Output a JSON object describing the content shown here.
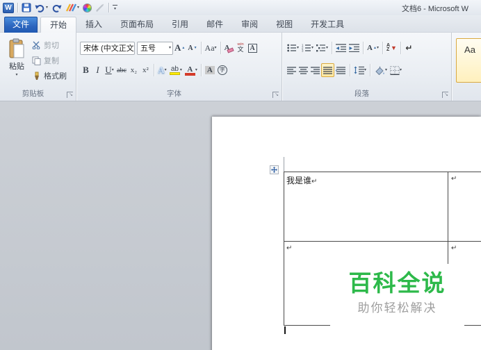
{
  "window": {
    "title": "文档6 - Microsoft W",
    "app_initial": "W"
  },
  "tabs": {
    "file": "文件",
    "active": "开始",
    "items": [
      "开始",
      "插入",
      "页面布局",
      "引用",
      "邮件",
      "审阅",
      "视图",
      "开发工具"
    ]
  },
  "ribbon": {
    "clipboard": {
      "label": "剪贴板",
      "paste": "粘贴",
      "cut": "剪切",
      "copy": "复制",
      "format_painter": "格式刷"
    },
    "font": {
      "label": "字体",
      "font_name": "宋体 (中文正文",
      "font_size": "五号",
      "bold": "B",
      "italic": "I",
      "underline": "U",
      "strike": "abc",
      "subscript": "x₂",
      "superscript": "x²",
      "change_case": "Aa",
      "clear_format": "A",
      "phonetic_ruby": "wén",
      "phonetic_char": "文",
      "char_border": "A",
      "text_effects": "A",
      "highlight": "ab",
      "font_color": "A",
      "char_shading": "A",
      "enclose": "字"
    },
    "paragraph": {
      "label": "段落",
      "show_marks": "↵",
      "asian": "A",
      "sort_top": "A",
      "sort_bottom": "Z"
    },
    "styles": {
      "first_item": "Aa"
    }
  },
  "document": {
    "cell_text": "我是谁",
    "pilcrow": "↵",
    "watermark": {
      "title": "百科全说",
      "subtitle": "助你轻松解决"
    }
  },
  "icons": {
    "dropdown": "▾",
    "launcher": "↘",
    "up": "▲",
    "down": "▼"
  },
  "colors": {
    "file_tab_blue": "#2f6bc6",
    "active_selection": "#ffe8a2",
    "watermark_green": "#2db94a",
    "watermark_gray": "#9e9e9e",
    "highlight_yellow": "#ffed00",
    "font_color_red": "#d43b2a"
  }
}
